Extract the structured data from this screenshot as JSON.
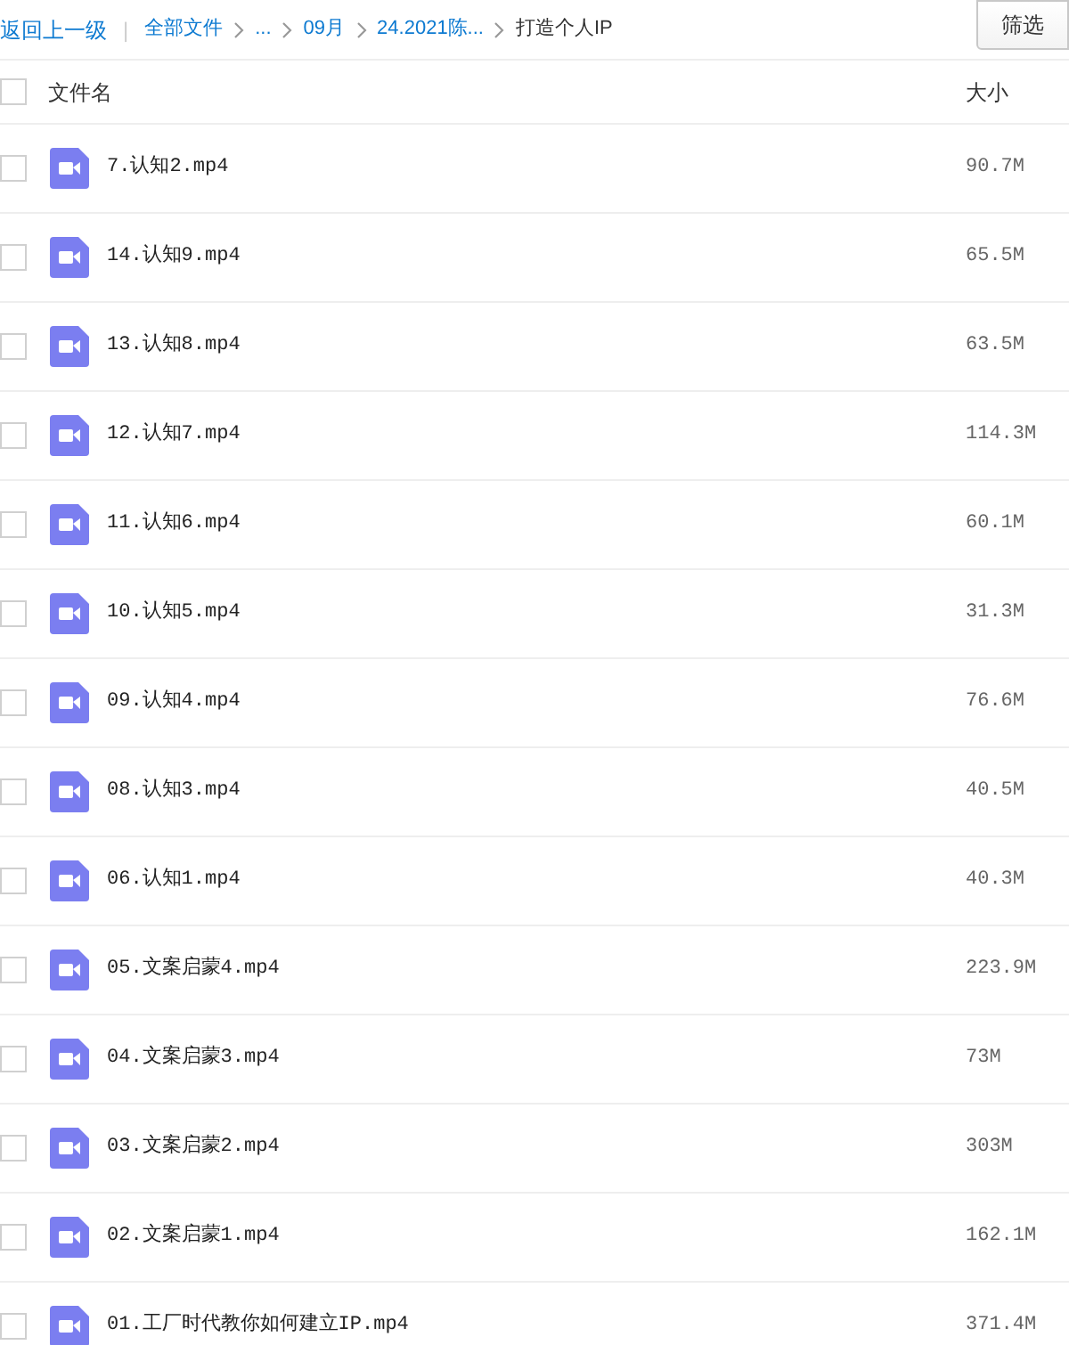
{
  "toolbar": {
    "back_link": "返回上一级",
    "separator": "|",
    "breadcrumb": [
      {
        "label": "全部文件",
        "kind": "link"
      },
      {
        "label": "...",
        "kind": "link"
      },
      {
        "label": "09月",
        "kind": "link"
      },
      {
        "label": "24.2021陈...",
        "kind": "link"
      },
      {
        "label": "打造个人IP",
        "kind": "current"
      }
    ],
    "filter_button": "筛选"
  },
  "table": {
    "columns": [
      "文件名",
      "大小"
    ],
    "select_all_checked": false,
    "rows": [
      {
        "name": "7.认知2.mp4",
        "size": "90.7M",
        "checked": false
      },
      {
        "name": "14.认知9.mp4",
        "size": "65.5M",
        "checked": false
      },
      {
        "name": "13.认知8.mp4",
        "size": "63.5M",
        "checked": false
      },
      {
        "name": "12.认知7.mp4",
        "size": "114.3M",
        "checked": false
      },
      {
        "name": "11.认知6.mp4",
        "size": "60.1M",
        "checked": false
      },
      {
        "name": "10.认知5.mp4",
        "size": "31.3M",
        "checked": false
      },
      {
        "name": "09.认知4.mp4",
        "size": "76.6M",
        "checked": false
      },
      {
        "name": "08.认知3.mp4",
        "size": "40.5M",
        "checked": false
      },
      {
        "name": "06.认知1.mp4",
        "size": "40.3M",
        "checked": false
      },
      {
        "name": "05.文案启蒙4.mp4",
        "size": "223.9M",
        "checked": false
      },
      {
        "name": "04.文案启蒙3.mp4",
        "size": "73M",
        "checked": false
      },
      {
        "name": "03.文案启蒙2.mp4",
        "size": "303M",
        "checked": false
      },
      {
        "name": "02.文案启蒙1.mp4",
        "size": "162.1M",
        "checked": false
      },
      {
        "name": "01.工厂时代教你如何建立IP.mp4",
        "size": "371.4M",
        "checked": false
      }
    ]
  }
}
